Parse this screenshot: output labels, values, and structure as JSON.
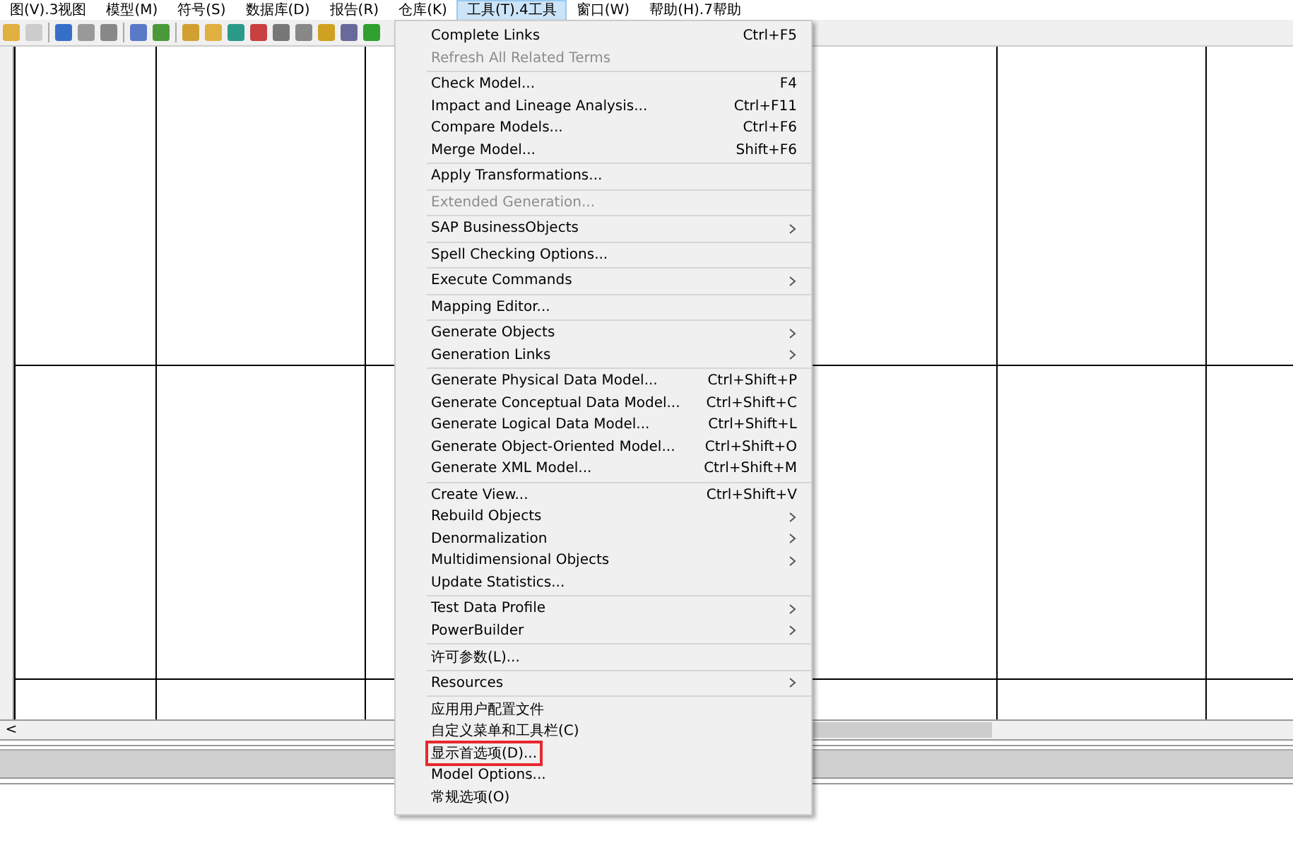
{
  "menu_bar": [
    {
      "label": "图(V).3视图",
      "selected": false
    },
    {
      "label": "模型(M)",
      "selected": false
    },
    {
      "label": "符号(S)",
      "selected": false
    },
    {
      "label": "数据库(D)",
      "selected": false
    },
    {
      "label": "报告(R)",
      "selected": false
    },
    {
      "label": "仓库(K)",
      "selected": false
    },
    {
      "label": "工具(T).4工具",
      "selected": true
    },
    {
      "label": "窗口(W)",
      "selected": false
    },
    {
      "label": "帮助(H).7帮助",
      "selected": false
    }
  ],
  "dropdown": {
    "groups": [
      [
        {
          "label": "Complete Links",
          "shortcut": "Ctrl+F5",
          "submenu": false,
          "disabled": false,
          "highlighted": false
        },
        {
          "label": "Refresh All Related Terms",
          "submenu": false,
          "disabled": true,
          "highlighted": false
        }
      ],
      [
        {
          "label": "Check Model...",
          "shortcut": "F4",
          "submenu": false,
          "disabled": false,
          "highlighted": false
        },
        {
          "label": "Impact and Lineage Analysis...",
          "shortcut": "Ctrl+F11",
          "submenu": false,
          "disabled": false,
          "highlighted": false
        },
        {
          "label": "Compare Models...",
          "shortcut": "Ctrl+F6",
          "submenu": false,
          "disabled": false,
          "highlighted": false
        },
        {
          "label": "Merge Model...",
          "shortcut": "Shift+F6",
          "submenu": false,
          "disabled": false,
          "highlighted": false
        }
      ],
      [
        {
          "label": "Apply Transformations...",
          "submenu": false,
          "disabled": false,
          "highlighted": false
        }
      ],
      [
        {
          "label": "Extended Generation...",
          "submenu": false,
          "disabled": true,
          "highlighted": false
        }
      ],
      [
        {
          "label": "SAP BusinessObjects",
          "submenu": true,
          "disabled": false,
          "highlighted": false
        }
      ],
      [
        {
          "label": "Spell Checking Options...",
          "submenu": false,
          "disabled": false,
          "highlighted": false
        }
      ],
      [
        {
          "label": "Execute Commands",
          "submenu": true,
          "disabled": false,
          "highlighted": false
        }
      ],
      [
        {
          "label": "Mapping Editor...",
          "submenu": false,
          "disabled": false,
          "highlighted": false
        }
      ],
      [
        {
          "label": "Generate Objects",
          "submenu": true,
          "disabled": false,
          "highlighted": false
        },
        {
          "label": "Generation Links",
          "submenu": true,
          "disabled": false,
          "highlighted": false
        }
      ],
      [
        {
          "label": "Generate Physical Data Model...",
          "shortcut": "Ctrl+Shift+P",
          "submenu": false,
          "disabled": false,
          "highlighted": false
        },
        {
          "label": "Generate Conceptual Data Model...",
          "shortcut": "Ctrl+Shift+C",
          "submenu": false,
          "disabled": false,
          "highlighted": false
        },
        {
          "label": "Generate Logical Data Model...",
          "shortcut": "Ctrl+Shift+L",
          "submenu": false,
          "disabled": false,
          "highlighted": false
        },
        {
          "label": "Generate Object-Oriented Model...",
          "shortcut": "Ctrl+Shift+O",
          "submenu": false,
          "disabled": false,
          "highlighted": false
        },
        {
          "label": "Generate XML Model...",
          "shortcut": "Ctrl+Shift+M",
          "submenu": false,
          "disabled": false,
          "highlighted": false
        }
      ],
      [
        {
          "label": "Create View...",
          "shortcut": "Ctrl+Shift+V",
          "submenu": false,
          "disabled": false,
          "highlighted": false
        },
        {
          "label": "Rebuild Objects",
          "submenu": true,
          "disabled": false,
          "highlighted": false
        },
        {
          "label": "Denormalization",
          "submenu": true,
          "disabled": false,
          "highlighted": false
        },
        {
          "label": "Multidimensional Objects",
          "submenu": true,
          "disabled": false,
          "highlighted": false
        },
        {
          "label": "Update Statistics...",
          "submenu": false,
          "disabled": false,
          "highlighted": false
        }
      ],
      [
        {
          "label": "Test Data Profile",
          "submenu": true,
          "disabled": false,
          "highlighted": false
        },
        {
          "label": "PowerBuilder",
          "submenu": true,
          "disabled": false,
          "highlighted": false
        }
      ],
      [
        {
          "label": "许可参数(L)...",
          "submenu": false,
          "disabled": false,
          "highlighted": false
        }
      ],
      [
        {
          "label": "Resources",
          "submenu": true,
          "disabled": false,
          "highlighted": false
        }
      ],
      [
        {
          "label": "应用用户配置文件",
          "submenu": false,
          "disabled": false,
          "highlighted": false
        },
        {
          "label": "自定义菜单和工具栏(C)",
          "submenu": false,
          "disabled": false,
          "highlighted": false
        },
        {
          "label": "显示首选项(D)...",
          "submenu": false,
          "disabled": false,
          "highlighted": true
        },
        {
          "label": "Model Options...",
          "submenu": false,
          "disabled": false,
          "highlighted": false
        },
        {
          "label": "常规选项(O)",
          "submenu": false,
          "disabled": false,
          "highlighted": false
        }
      ]
    ]
  },
  "scroll_arrow": "<"
}
